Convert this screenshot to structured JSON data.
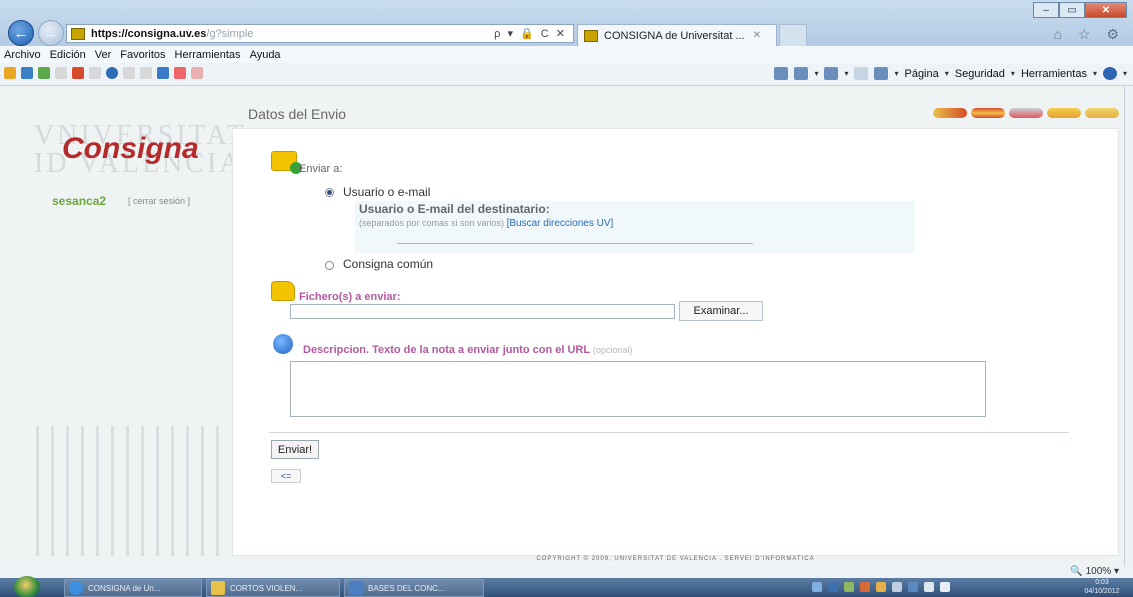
{
  "browser": {
    "url_host": "https://consigna.uv.es",
    "url_path": "/g?simple",
    "address_tools": "ρ ▾ 🔒 C ✕",
    "tab_title": "CONSIGNA de Universitat ...",
    "tab_close": "✕",
    "window_min": "–",
    "window_max": "▭",
    "window_close": "✕",
    "right_tools": "⌂ ☆ ⚙",
    "menu": [
      "Archivo",
      "Edición",
      "Ver",
      "Favoritos",
      "Herramientas",
      "Ayuda"
    ],
    "command_bar": [
      "Página",
      "Seguridad",
      "Herramientas"
    ],
    "zoom": "100%"
  },
  "sidebar": {
    "watermark_line1": "VNIVERSITAT",
    "watermark_line2": "ID VALENCIA",
    "brand": "Consigna",
    "user": "sesanca2",
    "logout": "[ cerrar sesión ]"
  },
  "main": {
    "section_title": "Datos del Envio",
    "enviar_a": "Enviar a:",
    "option_usuario": "Usuario o e-mail",
    "dest_label": "Usuario o E-mail del destinatario:",
    "dest_hint": "(separados por comas si son varios)",
    "buscar_link": "[Buscar direcciones UV]",
    "option_comun": "Consigna común",
    "fichero_label": "Fichero(s) a enviar:",
    "examinar": "Examinar...",
    "desc_label": "Descripcion. Texto de la nota a enviar junto con el URL",
    "desc_optional": "(opcional)",
    "enviar_button": "Enviar!",
    "back_button": "<="
  },
  "footer": "COPYRIGHT © 2009, UNIVERSITAT DE VALENCIA . SERVEI D'INFORMATICA",
  "taskbar": {
    "tasks": [
      "CONSIGNA de Un...",
      "CORTOS VIOLEN...",
      "BASES DEL CONC..."
    ],
    "clock_time": "0:03",
    "clock_date": "04/10/2012"
  }
}
